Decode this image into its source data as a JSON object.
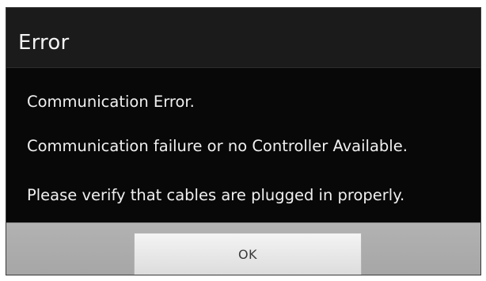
{
  "dialog": {
    "title": "Error",
    "messages": [
      "Communication Error.",
      "Communication failure or no Controller Available.",
      "Please verify that cables are plugged in properly."
    ],
    "ok_label": "OK"
  },
  "colors": {
    "dialog_background": "#0b0b0b",
    "header_background": "#1b1b1b",
    "text": "#f0f0f0",
    "button_bar": "#a6a6a6",
    "button_face": "#f4f4f4",
    "button_text": "#3a3a3a"
  }
}
